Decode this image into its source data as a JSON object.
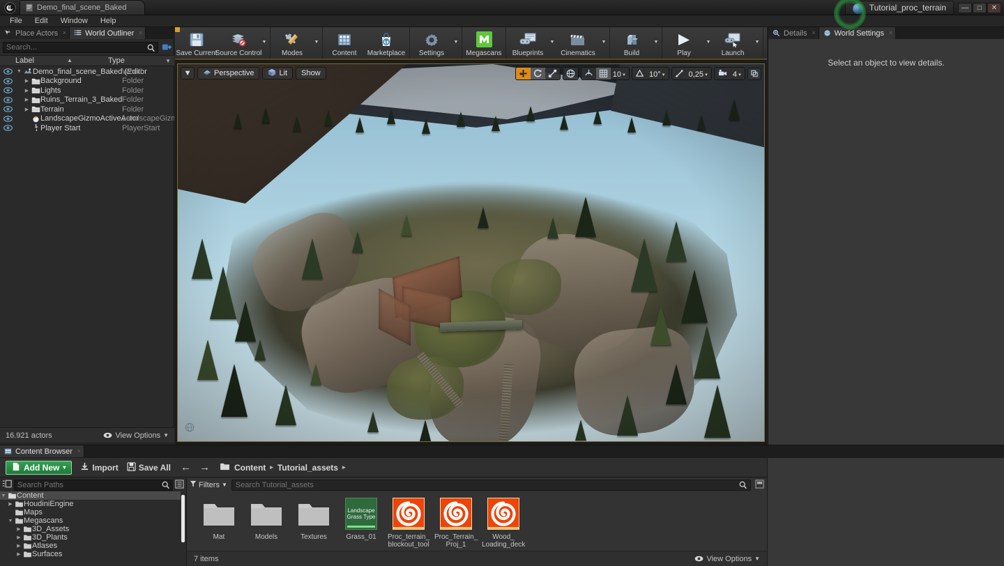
{
  "titlebar": {
    "app_icon": "unreal-logo-icon",
    "document_tab": "Demo_final_scene_Baked",
    "project_name": "Tutorial_proc_terrain",
    "minimize": "—",
    "maximize": "□",
    "close": "✕"
  },
  "menubar": {
    "items": [
      "File",
      "Edit",
      "Window",
      "Help"
    ]
  },
  "outliner": {
    "tabs": [
      {
        "label": "Place Actors",
        "icon": "place-actors-icon",
        "active": false
      },
      {
        "label": "World Outliner",
        "icon": "world-outliner-icon",
        "active": true
      }
    ],
    "search_placeholder": "Search...",
    "columns": {
      "label": "Label",
      "type": "Type"
    },
    "rows": [
      {
        "label": "Demo_final_scene_Baked (Editor",
        "type": "World",
        "depth": 0,
        "icon": "world-icon",
        "expander": "down"
      },
      {
        "label": "Background",
        "type": "Folder",
        "depth": 1,
        "icon": "folder-icon",
        "expander": "right"
      },
      {
        "label": "Lights",
        "type": "Folder",
        "depth": 1,
        "icon": "folder-icon",
        "expander": "right"
      },
      {
        "label": "Ruins_Terrain_3_Baked",
        "type": "Folder",
        "depth": 1,
        "icon": "folder-icon",
        "expander": "right"
      },
      {
        "label": "Terrain",
        "type": "Folder",
        "depth": 1,
        "icon": "folder-icon",
        "expander": "right"
      },
      {
        "label": "LandscapeGizmoActiveActor",
        "type": "LandscapeGizm",
        "depth": 1,
        "icon": "gizmo-icon",
        "expander": ""
      },
      {
        "label": "Player Start",
        "type": "PlayerStart",
        "depth": 1,
        "icon": "player-start-icon",
        "expander": ""
      }
    ],
    "footer": {
      "count": "16.921 actors",
      "view_options": "View Options"
    }
  },
  "toolbar": {
    "groups": [
      {
        "buttons": [
          {
            "label": "Save Current",
            "icon": "save-icon",
            "caret": false
          },
          {
            "label": "Source Control",
            "icon": "source-control-icon",
            "caret": true
          }
        ]
      },
      {
        "buttons": [
          {
            "label": "Modes",
            "icon": "modes-wrench-icon",
            "caret": true
          }
        ]
      },
      {
        "buttons": [
          {
            "label": "Content",
            "icon": "content-grid-icon",
            "caret": false
          },
          {
            "label": "Marketplace",
            "icon": "marketplace-bag-icon",
            "caret": false
          }
        ]
      },
      {
        "buttons": [
          {
            "label": "Settings",
            "icon": "settings-gear-icon",
            "caret": true
          }
        ]
      },
      {
        "buttons": [
          {
            "label": "Megascans",
            "icon": "megascans-m-icon",
            "caret": false
          }
        ]
      },
      {
        "buttons": [
          {
            "label": "Blueprints",
            "icon": "blueprints-icon",
            "caret": true
          },
          {
            "label": "Cinematics",
            "icon": "cinematics-clapper-icon",
            "caret": true
          }
        ]
      },
      {
        "buttons": [
          {
            "label": "Build",
            "icon": "build-cube-icon",
            "caret": true
          }
        ]
      },
      {
        "buttons": [
          {
            "label": "Play",
            "icon": "play-triangle-icon",
            "caret": true
          },
          {
            "label": "Launch",
            "icon": "launch-icon",
            "caret": true
          }
        ]
      }
    ]
  },
  "viewport": {
    "left_controls": {
      "view_menu": "▼",
      "perspective": "Perspective",
      "lit": "Lit",
      "show": "Show"
    },
    "right_controls": {
      "transform_modes": [
        "translate-gizmo-icon",
        "rotate-gizmo-icon",
        "scale-gizmo-icon"
      ],
      "coord_system": "world-coords-icon",
      "surface_snap": "surface-snap-icon",
      "grid_snap_toggle": "grid-snap-icon",
      "grid_snap_value": "10",
      "angle_snap_toggle": "angle-snap-icon",
      "angle_snap_value": "10°",
      "scale_snap_toggle": "scale-snap-icon",
      "scale_snap_value": "0,25",
      "camera_speed_icon": "camera-speed-icon",
      "camera_speed_value": "4",
      "maximize_icon": "maximize-viewport-icon"
    },
    "overlay_icon": "world-globe-icon"
  },
  "details": {
    "tabs": [
      {
        "label": "Details",
        "icon": "details-magnifier-icon",
        "active": false
      },
      {
        "label": "World Settings",
        "icon": "world-settings-icon",
        "active": true
      }
    ],
    "empty_message": "Select an object to view details."
  },
  "content_browser": {
    "tab": {
      "label": "Content Browser",
      "icon": "content-browser-icon"
    },
    "toolbar": {
      "add_new": "Add New",
      "add_new_caret": "▾",
      "import": "Import",
      "save_all": "Save All",
      "back_arrow": "←",
      "forward_arrow": "→",
      "breadcrumb": [
        "Content",
        "Tutorial_assets"
      ],
      "breadcrumb_sep": "▸",
      "lock_icon": "lock-open-icon"
    },
    "paths": {
      "search_placeholder": "Search Paths",
      "tree": [
        {
          "label": "Content",
          "depth": 0,
          "expander": "down",
          "selected": true
        },
        {
          "label": "HoudiniEngine",
          "depth": 1,
          "expander": "right",
          "selected": false
        },
        {
          "label": "Maps",
          "depth": 1,
          "expander": "",
          "selected": false
        },
        {
          "label": "Megascans",
          "depth": 1,
          "expander": "down",
          "selected": false
        },
        {
          "label": "3D_Assets",
          "depth": 2,
          "expander": "right",
          "selected": false
        },
        {
          "label": "3D_Plants",
          "depth": 2,
          "expander": "right",
          "selected": false
        },
        {
          "label": "Atlases",
          "depth": 2,
          "expander": "right",
          "selected": false
        },
        {
          "label": "Surfaces",
          "depth": 2,
          "expander": "right",
          "selected": false
        }
      ]
    },
    "assets": {
      "filters_label": "Filters",
      "search_placeholder": "Search Tutorial_assets",
      "items": [
        {
          "name": "Mat",
          "kind": "folder"
        },
        {
          "name": "Models",
          "kind": "folder"
        },
        {
          "name": "Textures",
          "kind": "folder"
        },
        {
          "name": "Grass_01",
          "kind": "landscape-grass-type",
          "thumb_text": "Landscape Grass Type"
        },
        {
          "name": "Proc_terrain_ blockout_tool",
          "kind": "houdini-digital-asset"
        },
        {
          "name": "Proc_Terrain_ Proj_1",
          "kind": "houdini-digital-asset"
        },
        {
          "name": "Wood_ Loading_deck",
          "kind": "houdini-digital-asset"
        }
      ],
      "footer_count": "7 items",
      "view_options": "View Options"
    }
  },
  "colors": {
    "accent_orange": "#e08a18",
    "add_new_green": "#34a052",
    "hda_orange": "#ee4409",
    "grass_green": "#2f6a3d",
    "highlight_ring": "#28be46"
  }
}
